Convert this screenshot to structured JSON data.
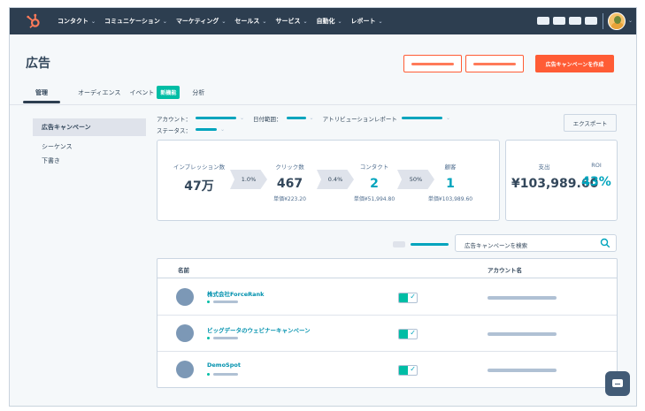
{
  "nav": {
    "items": [
      {
        "label": "コンタクト"
      },
      {
        "label": "コミュニケーション"
      },
      {
        "label": "マーケティング"
      },
      {
        "label": "セールス"
      },
      {
        "label": "サービス"
      },
      {
        "label": "自動化"
      },
      {
        "label": "レポート"
      }
    ],
    "chevron": "⌄"
  },
  "header": {
    "title": "広告",
    "create_button": "広告キャンペーンを作成",
    "tabs": {
      "manage": "管理",
      "audience": "オーディエンス",
      "events": "イベント",
      "new_badge": "新機能",
      "analytics": "分析"
    }
  },
  "sidebar": {
    "items": [
      {
        "label": "広告キャンペーン"
      },
      {
        "label": "シーケンス"
      },
      {
        "label": "下書き"
      }
    ]
  },
  "filters": {
    "account_label": "アカウント：",
    "date_label": "日付範囲：",
    "attribution_label": "アトリビューションレポート",
    "status_label": "ステータス："
  },
  "export_label": "エクスポート",
  "funnel": {
    "impressions": {
      "label": "インプレッション数",
      "value": "47万"
    },
    "rate1": "1.0%",
    "clicks": {
      "label": "クリック数",
      "value": "467",
      "sub": "単価¥223.20"
    },
    "rate2": "0.4%",
    "contacts": {
      "label": "コンタクト",
      "value": "2",
      "sub": "単価¥51,994.80"
    },
    "rate3": "50%",
    "customers": {
      "label": "顧客",
      "value": "1",
      "sub": "単価¥103,989.60"
    }
  },
  "summary": {
    "spend_label": "支出",
    "spend_value": "¥103,989.60",
    "roi_label": "ROI",
    "roi_value": "43%"
  },
  "search": {
    "placeholder": "広告キャンペーンを検索"
  },
  "table": {
    "headers": {
      "name": "名前",
      "account": "アカウント名"
    },
    "rows": [
      {
        "name": "株式会社ForceRank"
      },
      {
        "name": "ビッグデータのウェビナーキャンペーン"
      },
      {
        "name": "DemoSpot"
      }
    ]
  },
  "colors": {
    "accent_orange": "#ff5c35",
    "teal": "#00a4bd",
    "nav_bg": "#2d3e50"
  }
}
